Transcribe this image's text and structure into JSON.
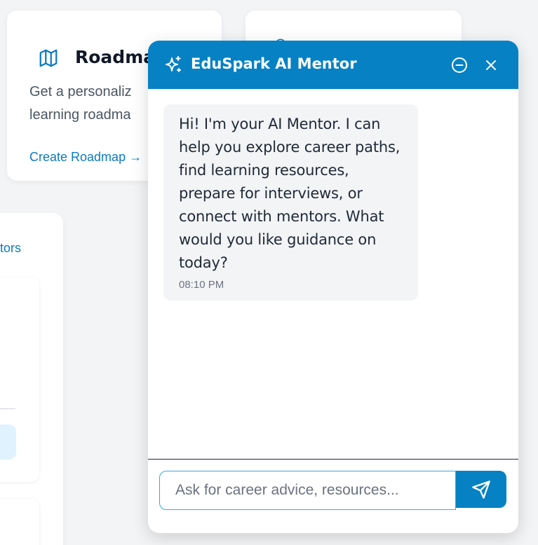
{
  "roadmap_card": {
    "title": "Roadmap",
    "description": "Get a personaliz\nlearning roadma",
    "link": "Create Roadmap →"
  },
  "mentors_card": {
    "link": "entors"
  },
  "chat": {
    "title": "EduSpark AI Mentor",
    "message": {
      "text": "Hi! I'm your AI Mentor. I can help you explore career paths, find learning resources, prepare for interviews, or connect with mentors. What would you like guidance on today?",
      "time": "08:10 PM"
    },
    "input": {
      "placeholder": "Ask for career advice, resources...",
      "value": ""
    }
  },
  "colors": {
    "accent": "#0581c4",
    "link": "#0b7bbf",
    "bubble_bg": "#f3f4f6"
  },
  "icons": [
    "map-icon",
    "profile-icon",
    "sparkles-icon",
    "minimize-icon",
    "close-icon",
    "send-icon"
  ]
}
